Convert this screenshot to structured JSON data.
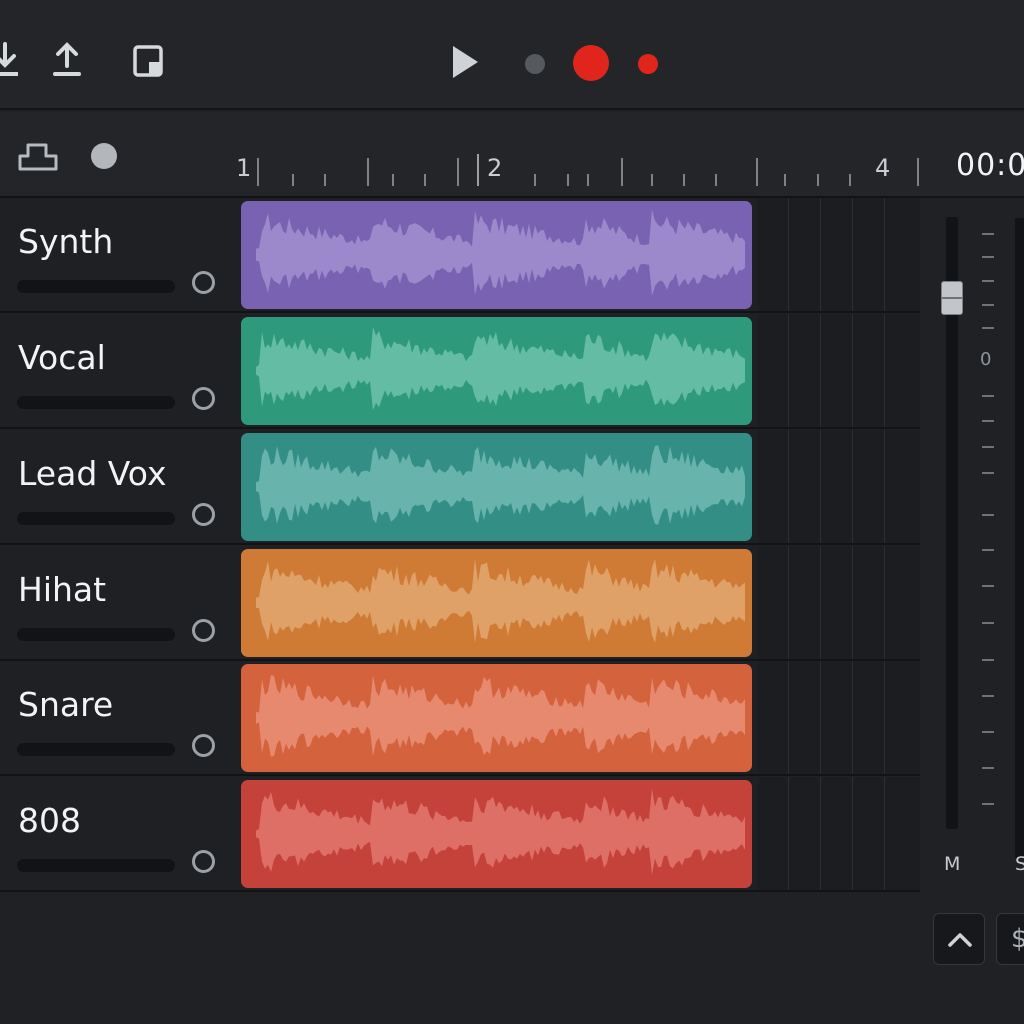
{
  "toolbar": {
    "icons": [
      "download-icon",
      "upload-icon",
      "window-icon",
      "play-icon",
      "record-off-icon",
      "record-icon",
      "record-small-icon"
    ],
    "colors": {
      "record": "#e0261c",
      "record_off": "#56595d"
    }
  },
  "timeline": {
    "ruler_labels": [
      "1",
      "2",
      "4"
    ],
    "time_readout": "00:0"
  },
  "tracks": [
    {
      "name": "Synth",
      "color": "#7a62b3",
      "wave": "#a290d0"
    },
    {
      "name": "Vocal",
      "color": "#2f9a7b",
      "wave": "#6fc2ac"
    },
    {
      "name": "Lead Vox",
      "color": "#338f86",
      "wave": "#72bab3"
    },
    {
      "name": "Hihat",
      "color": "#cf7b35",
      "wave": "#e2a871"
    },
    {
      "name": "Snare",
      "color": "#d3623d",
      "wave": "#e99077"
    },
    {
      "name": "808",
      "color": "#c5423a",
      "wave": "#e07770"
    }
  ],
  "mixer": {
    "zero_label": "0",
    "mute_label": "M",
    "solo_label": "S"
  },
  "bottom": {
    "dollar_label": "$"
  }
}
